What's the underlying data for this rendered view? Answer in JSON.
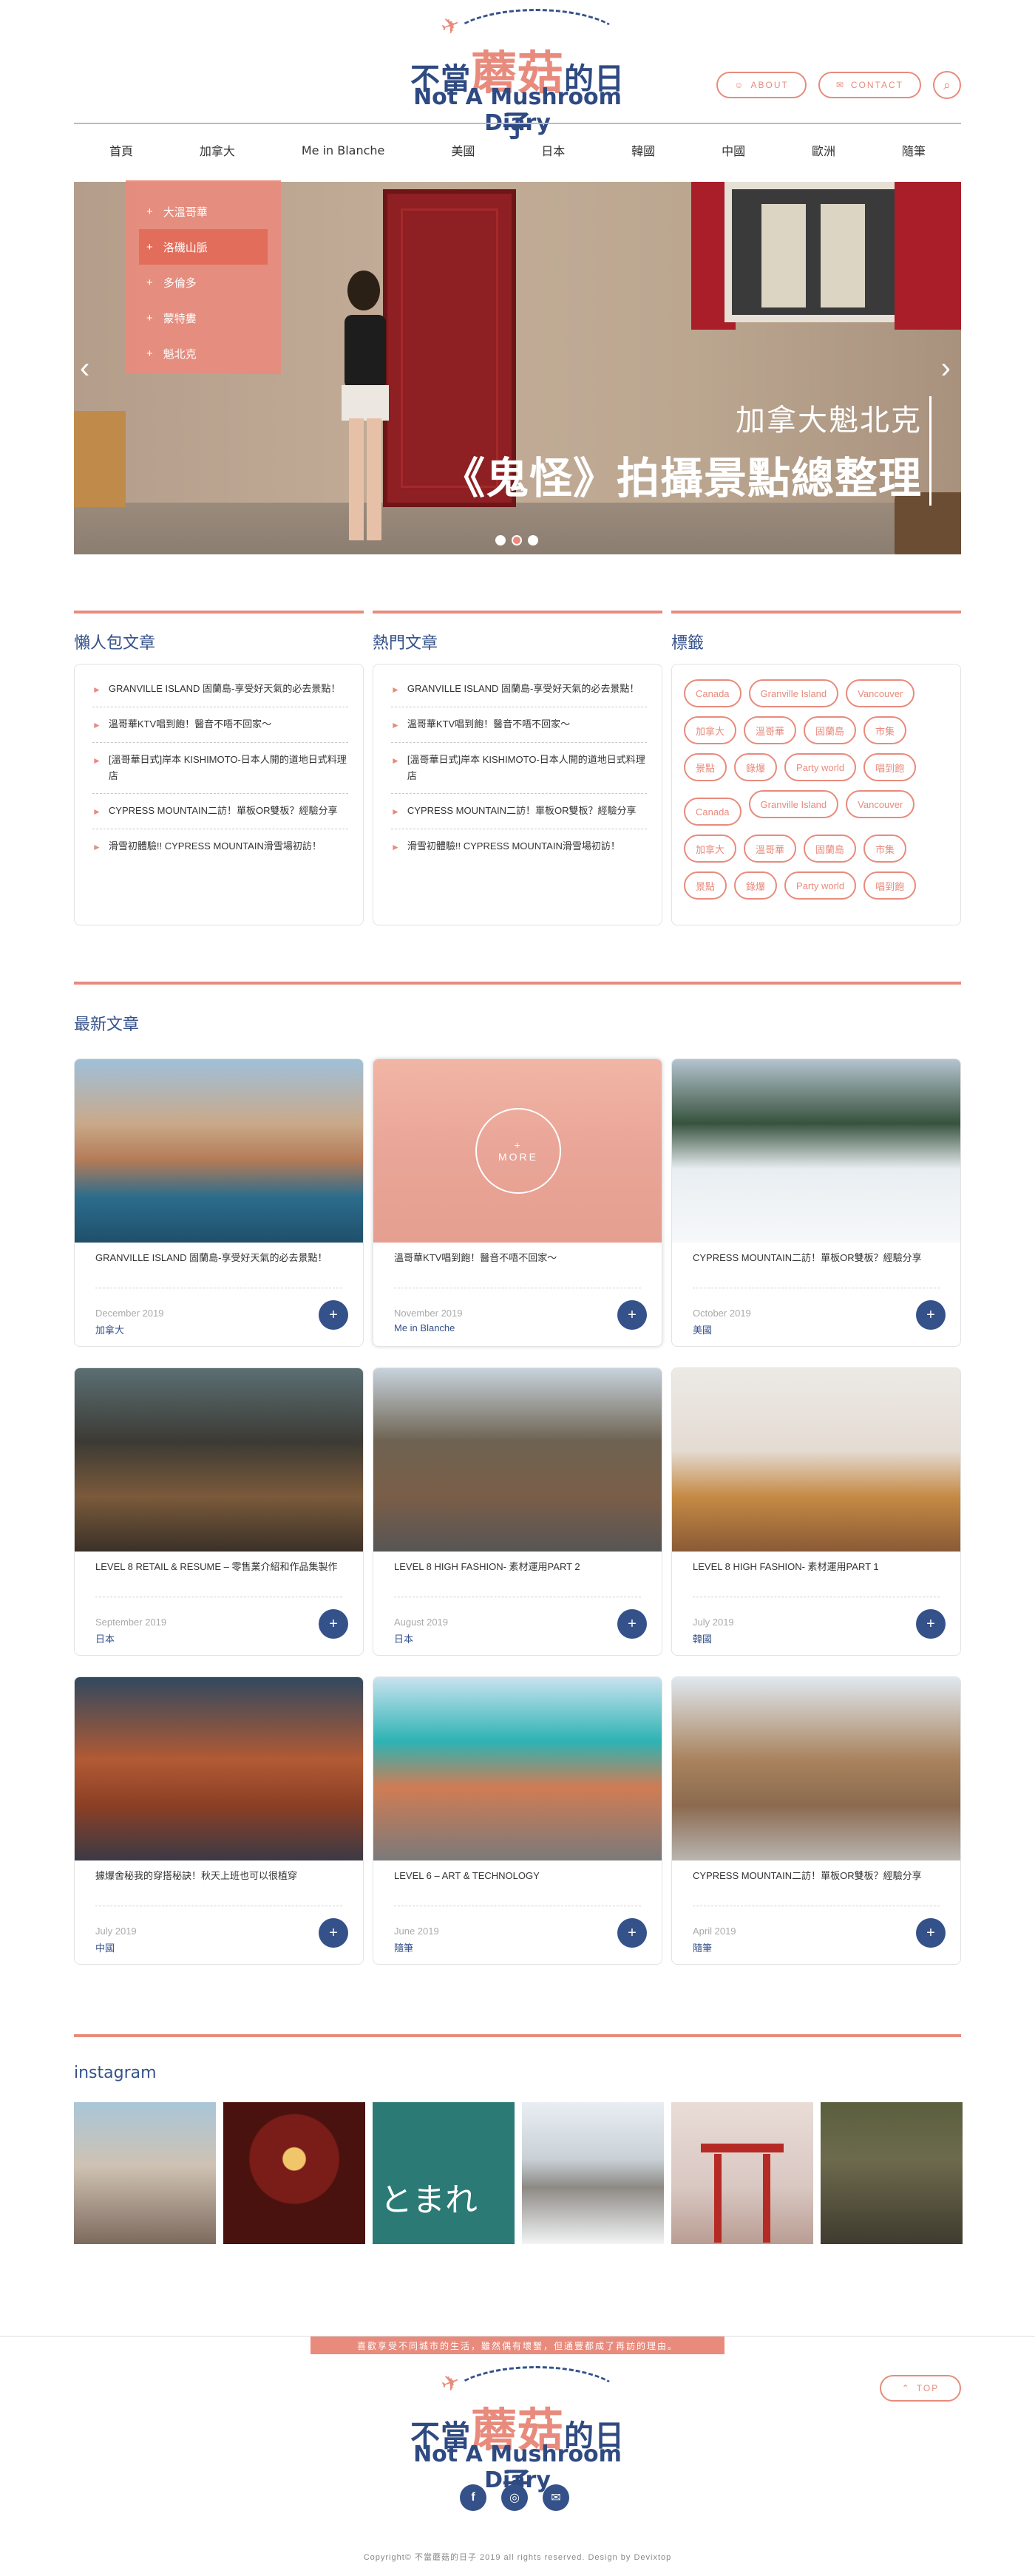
{
  "header": {
    "logo_zh_prefix": "不當",
    "logo_zh_highlight": "蘑菇",
    "logo_zh_suffix": "的日子",
    "logo_en": "Not A Mushroom Diary",
    "about_label": "ABOUT",
    "contact_label": "CONTACT"
  },
  "nav": [
    "首頁",
    "加拿大",
    "Me in Blanche",
    "美國",
    "日本",
    "韓國",
    "中國",
    "歐洲",
    "隨筆"
  ],
  "dropdown": [
    "大溫哥華",
    "洛磯山脈",
    "多倫多",
    "蒙特婁",
    "魁北克"
  ],
  "hero": {
    "caption_line1": "加拿大魁北克",
    "caption_line2": "《鬼怪》拍攝景點總整理"
  },
  "lazy": {
    "title": "懶人包文章",
    "items": [
      "GRANVILLE ISLAND 固蘭島-享受好天氣的必去景點！",
      "溫哥華KTV唱到飽！醫音不唔不回家～",
      "[溫哥華日式]岸本 KISHIMOTO-日本人開的道地日式料理店",
      "CYPRESS MOUNTAIN二訪！單板OR雙板？經驗分享",
      "滑雪初體驗!! CYPRESS MOUNTAIN滑雪場初訪！"
    ]
  },
  "popular": {
    "title": "熱門文章",
    "items": [
      "GRANVILLE ISLAND 固蘭島-享受好天氣的必去景點！",
      "溫哥華KTV唱到飽！醫音不唔不回家～",
      "[溫哥華日式]岸本 KISHIMOTO-日本人開的道地日式料理店",
      "CYPRESS MOUNTAIN二訪！單板OR雙板？經驗分享",
      "滑雪初體驗!! CYPRESS MOUNTAIN滑雪場初訪！"
    ]
  },
  "tags": {
    "title": "標籤",
    "items": [
      "Canada",
      "Granville Island",
      "Vancouver",
      "加拿大",
      "溫哥華",
      "固蘭島",
      "市集",
      "景點",
      "錄爆",
      "Party world",
      "唱到飽",
      "Canada",
      "Granville Island",
      "Vancouver",
      "加拿大",
      "溫哥華",
      "固蘭島",
      "市集",
      "景點",
      "錄爆",
      "Party world",
      "唱到飽"
    ]
  },
  "latest": {
    "title": "最新文章",
    "more_label": "MORE",
    "cards": [
      {
        "title": "GRANVILLE ISLAND 固蘭島-享受好天氣的必去景點！",
        "date": "December 2019",
        "cat": "加拿大"
      },
      {
        "title": "溫哥華KTV唱到飽！醫音不唔不回家～",
        "date": "November 2019",
        "cat": "Me in Blanche"
      },
      {
        "title": "CYPRESS MOUNTAIN二訪！單板OR雙板？經驗分享",
        "date": "October 2019",
        "cat": "美國"
      },
      {
        "title": "LEVEL 8 RETAIL & RESUME – 零售業介紹和作品集製作",
        "date": "September 2019",
        "cat": "日本"
      },
      {
        "title": "LEVEL 8 HIGH FASHION- 素材運用PART 2",
        "date": "August 2019",
        "cat": "日本"
      },
      {
        "title": "LEVEL 8 HIGH FASHION- 素材運用PART 1",
        "date": "July 2019",
        "cat": "韓國"
      },
      {
        "title": "據爆舍秘我的穿搭秘訣！秋天上班也可以很植穿",
        "date": "July 2019",
        "cat": "中國"
      },
      {
        "title": "LEVEL 6 – ART & TECHNOLOGY",
        "date": "June 2019",
        "cat": "隨筆"
      },
      {
        "title": "CYPRESS MOUNTAIN二訪！單板OR雙板？經驗分享",
        "date": "April 2019",
        "cat": "隨筆"
      }
    ]
  },
  "instagram": {
    "title": "instagram",
    "sign_text": "とまれ"
  },
  "footer": {
    "slogan": "喜歡享受不同城市的生活，雖然偶有壞蟹，但通豐都成了再訪的理由。",
    "top_label": "TOP",
    "copyright": "Copyright© 不當蘑菇的日子 2019 all rights reserved.  Design by Devixtop"
  },
  "colors": {
    "accent": "#e88b7d",
    "navy": "#34518a"
  }
}
